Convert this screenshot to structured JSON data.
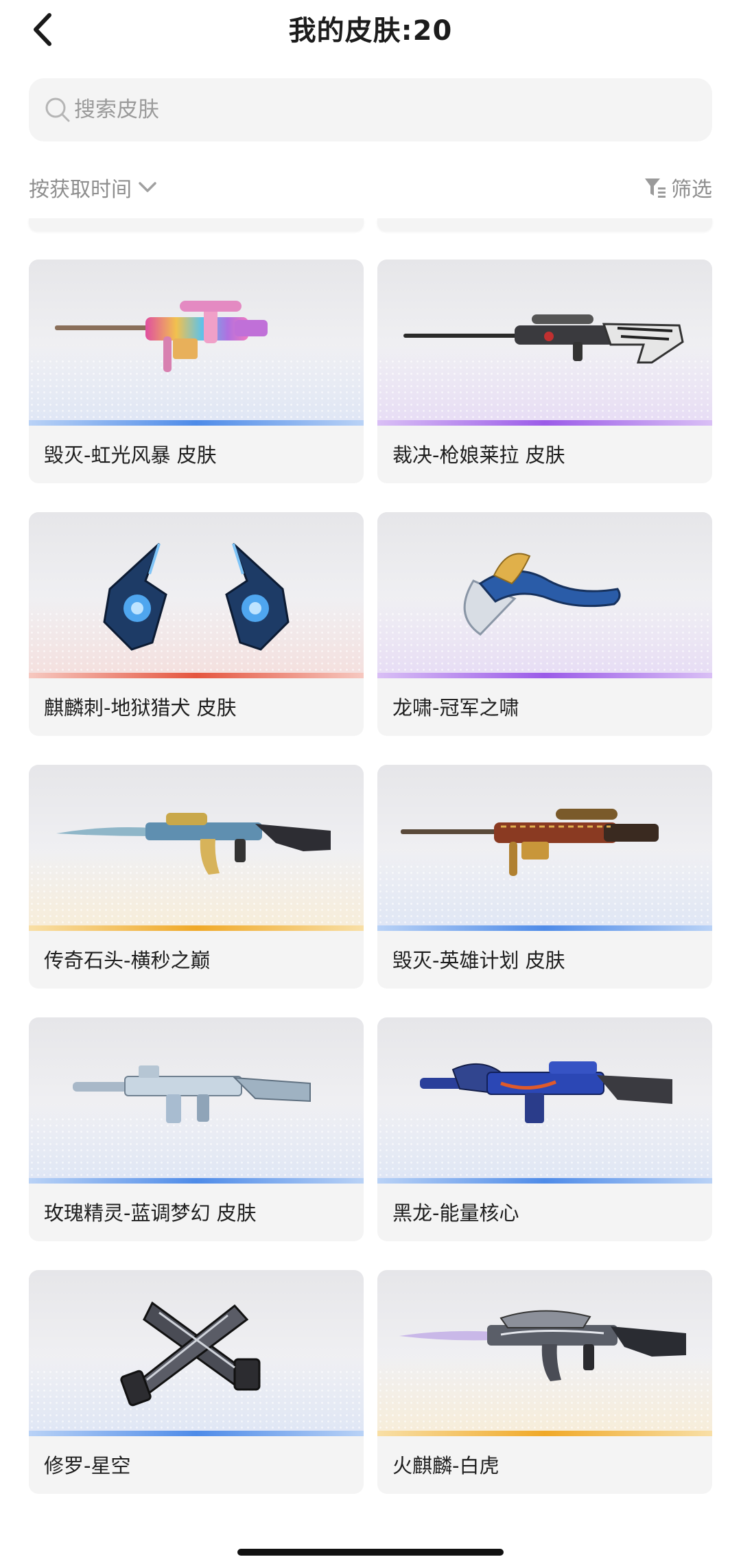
{
  "header": {
    "title": "我的皮肤:20",
    "back_icon": "chevron-left-icon"
  },
  "search": {
    "placeholder": "搜索皮肤",
    "value": ""
  },
  "toolbar": {
    "sort_label": "按获取时间",
    "filter_label": "筛选"
  },
  "rarity_colors": {
    "blue": "#4e8be8",
    "purple": "#9b5be8",
    "red": "#e5553f",
    "gold": "#f0a928"
  },
  "skins": [
    {
      "name": "毁灭-虹光风暴 皮肤",
      "rarity": "blue",
      "icon": "sniper-rifle-icon"
    },
    {
      "name": "裁决-枪娘莱拉 皮肤",
      "rarity": "purple",
      "icon": "sniper-rifle-icon"
    },
    {
      "name": "麒麟刺-地狱猎犬 皮肤",
      "rarity": "red",
      "icon": "claw-blades-icon"
    },
    {
      "name": "龙啸-冠军之啸",
      "rarity": "purple",
      "icon": "axe-icon"
    },
    {
      "name": "传奇石头-横秒之巅",
      "rarity": "gold",
      "icon": "assault-rifle-icon"
    },
    {
      "name": "毁灭-英雄计划 皮肤",
      "rarity": "blue",
      "icon": "sniper-rifle-icon"
    },
    {
      "name": "玫瑰精灵-蓝调梦幻 皮肤",
      "rarity": "blue",
      "icon": "assault-rifle-icon"
    },
    {
      "name": "黑龙-能量核心",
      "rarity": "blue",
      "icon": "assault-rifle-icon"
    },
    {
      "name": "修罗-星空",
      "rarity": "blue",
      "icon": "dual-pistol-icon"
    },
    {
      "name": "火麒麟-白虎",
      "rarity": "gold",
      "icon": "assault-rifle-icon"
    }
  ]
}
